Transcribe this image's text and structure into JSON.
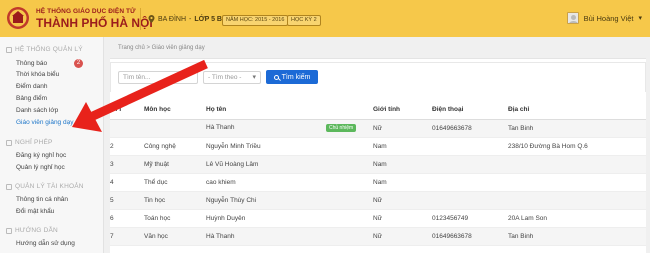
{
  "header": {
    "system_name": "HỆ THỐNG GIÁO DỤC ĐIỆN TỬ",
    "city_name": "THÀNH PHỐ HÀ NỘI",
    "district": "BA ĐÌNH",
    "class_label": "LỚP 5 B",
    "school_year": "NĂM HỌC: 2015 - 2016",
    "semester": "HỌC KỲ 2",
    "user_name": "Bùi Hoàng Việt"
  },
  "sidebar": {
    "sections": [
      {
        "title": "HỆ THỐNG QUẢN LÝ",
        "items": [
          "Thông báo",
          "Thời khóa biểu",
          "Điểm danh",
          "Bảng điểm",
          "Danh sách lớp",
          "Giáo viên giảng dạy"
        ]
      },
      {
        "title": "NGHỈ PHÉP",
        "items": [
          "Đăng ký nghỉ học",
          "Quản lý nghỉ học"
        ]
      },
      {
        "title": "QUẢN LÝ TÀI KHOẢN",
        "items": [
          "Thông tin cá nhân",
          "Đổi mật khẩu"
        ]
      },
      {
        "title": "HƯỚNG DẪN",
        "items": [
          "Hướng dẫn sử dụng"
        ]
      }
    ],
    "notification_count": "2"
  },
  "breadcrumb": {
    "home": "Trang chủ",
    "sep": ">",
    "current": "Giáo viên giảng dạy"
  },
  "search": {
    "name_placeholder": "Tìm tên...",
    "filter_placeholder": "- Tìm theo -",
    "button_label": "Tìm kiếm"
  },
  "table": {
    "headers": [
      "STT",
      "Môn học",
      "Họ tên",
      "Giới tính",
      "Điện thoại",
      "Địa chỉ"
    ],
    "rows": [
      {
        "stt": "",
        "subject": "",
        "name": "Hà Thanh",
        "tag": "Chủ nhiệm",
        "gender": "Nữ",
        "phone": "01649663678",
        "address": "Tan Binh"
      },
      {
        "stt": "2",
        "subject": "Công nghệ",
        "name": "Nguyễn Minh Triều",
        "tag": "",
        "gender": "Nam",
        "phone": "",
        "address": "238/10 Đường Bà Hom Q.6"
      },
      {
        "stt": "3",
        "subject": "Mỹ thuật",
        "name": "Lê Vũ Hoàng Lâm",
        "tag": "",
        "gender": "Nam",
        "phone": "",
        "address": ""
      },
      {
        "stt": "4",
        "subject": "Thể dục",
        "name": "cao khiem",
        "tag": "",
        "gender": "Nam",
        "phone": "",
        "address": ""
      },
      {
        "stt": "5",
        "subject": "Tin học",
        "name": "Nguyễn Thùy Chi",
        "tag": "",
        "gender": "Nữ",
        "phone": "",
        "address": ""
      },
      {
        "stt": "6",
        "subject": "Toán học",
        "name": "Huỳnh Duyên",
        "tag": "",
        "gender": "Nữ",
        "phone": "0123456749",
        "address": "20A Lam Son"
      },
      {
        "stt": "7",
        "subject": "Văn học",
        "name": "Hà Thanh",
        "tag": "",
        "gender": "Nữ",
        "phone": "01649663678",
        "address": "Tan Binh"
      }
    ]
  },
  "colors": {
    "header_bg": "#f6c84a",
    "brand_red": "#9b1c1c",
    "primary_button": "#1c6ad6",
    "active_link": "#1f77c9",
    "homeroom_tag": "#5cb85c",
    "annotation_arrow": "#e8221b"
  }
}
